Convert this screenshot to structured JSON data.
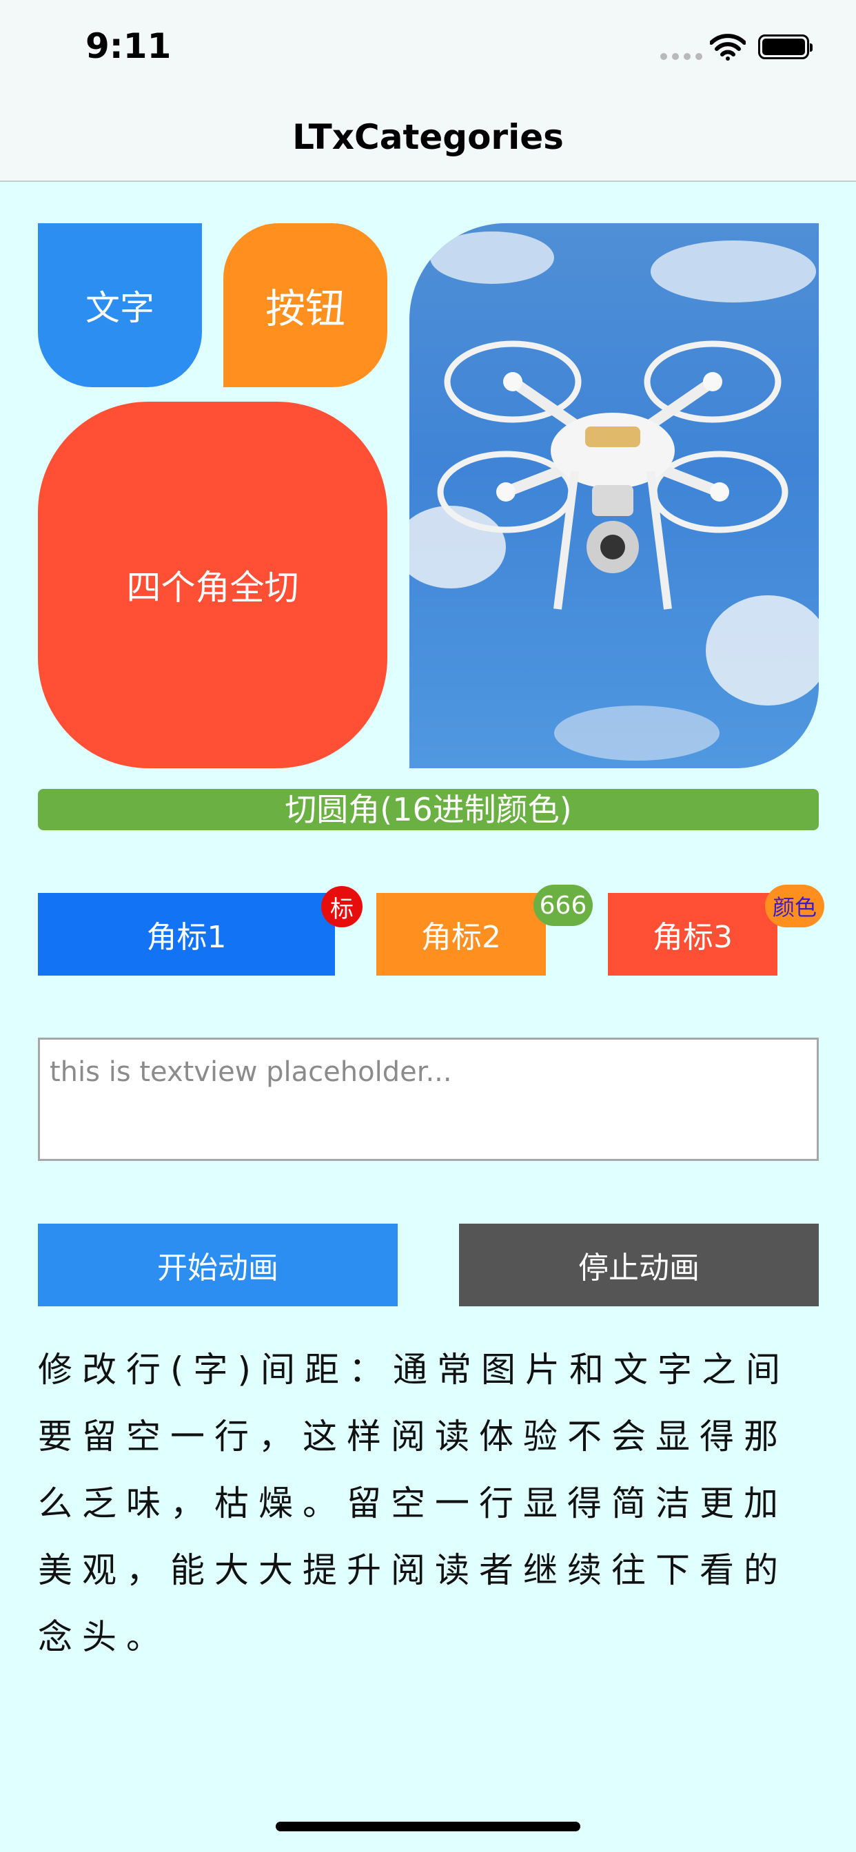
{
  "status_bar": {
    "time": "9:11"
  },
  "nav": {
    "title": "LTxCategories"
  },
  "tiles": {
    "text_label": "文字",
    "button_label": "按钮",
    "all_corners_label": "四个角全切"
  },
  "rounded_bar": {
    "label": "切圆角(16进制颜色)"
  },
  "badge_buttons": [
    {
      "label": "角标1",
      "badge": "标"
    },
    {
      "label": "角标2",
      "badge": "666"
    },
    {
      "label": "角标3",
      "badge": "颜色"
    }
  ],
  "textview": {
    "placeholder": "this is textview placeholder..."
  },
  "animation": {
    "start_label": "开始动画",
    "stop_label": "停止动画"
  },
  "paragraph": "修改行(字)间距：通常图片和文字之间要留空一行，这样阅读体验不会显得那么乏味，枯燥。留空一行显得简洁更加美观，能大大提升阅读者继续往下看的念头。",
  "colors": {
    "background": "#e0ffff",
    "blue": "#2b8ef0",
    "orange": "#ff8f1f",
    "red": "#ff4f35",
    "green": "#6bb043",
    "dark_gray": "#555555"
  },
  "icons": [
    "signal-icon",
    "wifi-icon",
    "battery-icon",
    "drone-image"
  ]
}
